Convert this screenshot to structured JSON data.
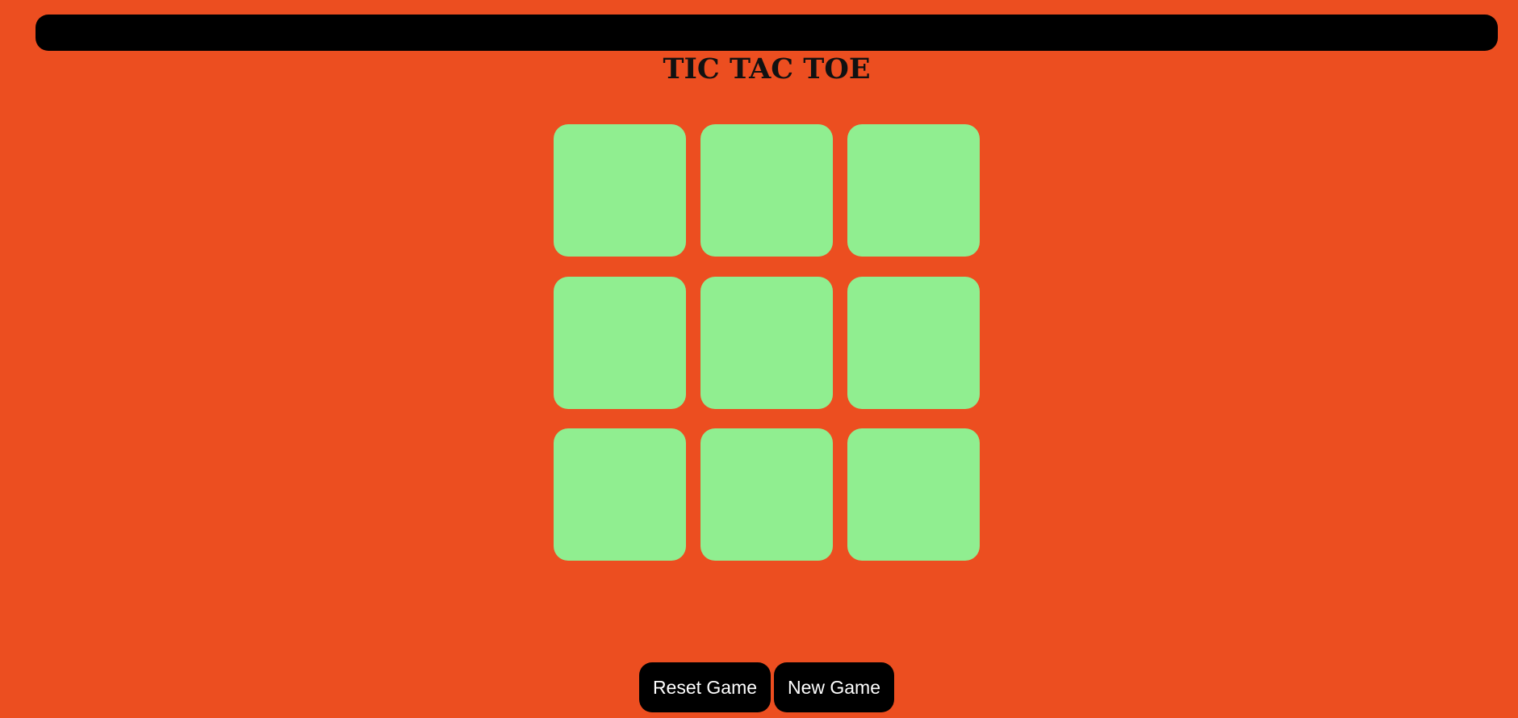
{
  "header": {
    "title": "TIC TAC TOE"
  },
  "board": {
    "cells": [
      "",
      "",
      "",
      "",
      "",
      "",
      "",
      "",
      ""
    ]
  },
  "controls": {
    "reset_label": "Reset Game",
    "new_label": "New Game"
  },
  "colors": {
    "background": "#ec4e20",
    "cell": "#90ee90",
    "bar": "#000000",
    "button": "#000000",
    "button_text": "#ffffff"
  }
}
